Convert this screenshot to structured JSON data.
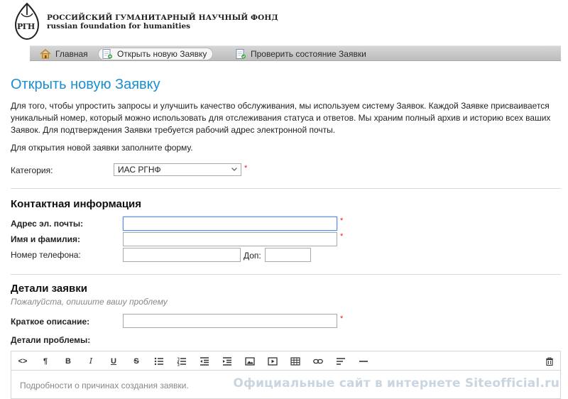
{
  "header": {
    "org_name_ru": "РОССИЙСКИЙ ГУМАНИТАРНЫЙ НАУЧНЫЙ ФОНД",
    "org_name_en": "russian foundation for humanities",
    "emblem_text": "РГН"
  },
  "nav": {
    "items": [
      {
        "label": "Главная",
        "icon": "home-icon"
      },
      {
        "label": "Открыть новую Заявку",
        "icon": "new-ticket-icon",
        "active": true
      },
      {
        "label": "Проверить состояние Заявки",
        "icon": "check-status-icon"
      }
    ]
  },
  "page": {
    "title": "Открыть новую Заявку",
    "intro": "Для того, чтобы упростить запросы и улучшить качество обслуживания, мы используем систему Заявок. Каждой Заявке присваивается уникальный номер, который можно использовать для отслеживания статуса и ответов. Мы храним полный архив и историю всех ваших Заявок. Для подтверждения Заявки требуется рабочий адрес электронной почты.",
    "intro2": "Для открытия новой заявки заполните форму."
  },
  "category": {
    "label": "Категория:",
    "selected": "ИАС РГНФ",
    "required": "*"
  },
  "contact": {
    "title": "Контактная информация",
    "email_label": "Адрес эл. почты:",
    "email_value": "",
    "name_label": "Имя и фамилия:",
    "name_value": "",
    "phone_label": "Номер телефона:",
    "phone_value": "",
    "ext_label": "Доп:",
    "ext_value": "",
    "required": "*"
  },
  "details": {
    "title": "Детали заявки",
    "subtitle": "Пожалуйста, опишите вашу проблему",
    "summary_label": "Краткое описание:",
    "summary_value": "",
    "problem_label": "Детали проблемы:",
    "placeholder": "Подробности о причинах создания заявки.",
    "required": "*"
  },
  "toolbar": {
    "buttons": [
      "code-view-icon",
      "paragraph-icon",
      "bold-icon",
      "italic-icon",
      "underline-icon",
      "strikethrough-icon",
      "bullet-list-icon",
      "numbered-list-icon",
      "outdent-icon",
      "indent-icon",
      "image-icon",
      "video-icon",
      "table-icon",
      "link-icon",
      "align-icon",
      "horizontal-rule-icon",
      "trash-icon"
    ],
    "labels": {
      "code": "<>",
      "paragraph": "¶",
      "bold": "B",
      "italic": "I",
      "underline": "U",
      "strike": "S"
    }
  },
  "watermark": "Официальные сайт в интернете Siteofficial.ru",
  "colors": {
    "title_blue": "#1b8ed1",
    "required_red": "#e02020",
    "focus_blue": "#5b8fd9"
  }
}
